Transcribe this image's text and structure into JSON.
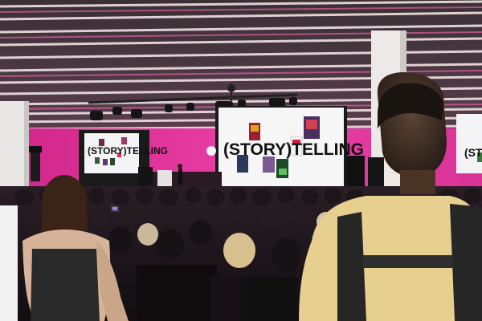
{
  "scene": {
    "big_screen_title": "(STORY)TELLING",
    "left_screen_title": "(STORY)TELLING",
    "right_screen_title": "(ST"
  },
  "colors": {
    "wall_magenta": "#e0339a",
    "screen_white": "#f4f4f6",
    "ceiling_slat": "#e8d8dc",
    "ceiling_shadow": "#2a2226",
    "crowd_dark": "#141014",
    "shirt_yellow": "#e6cf8f"
  }
}
